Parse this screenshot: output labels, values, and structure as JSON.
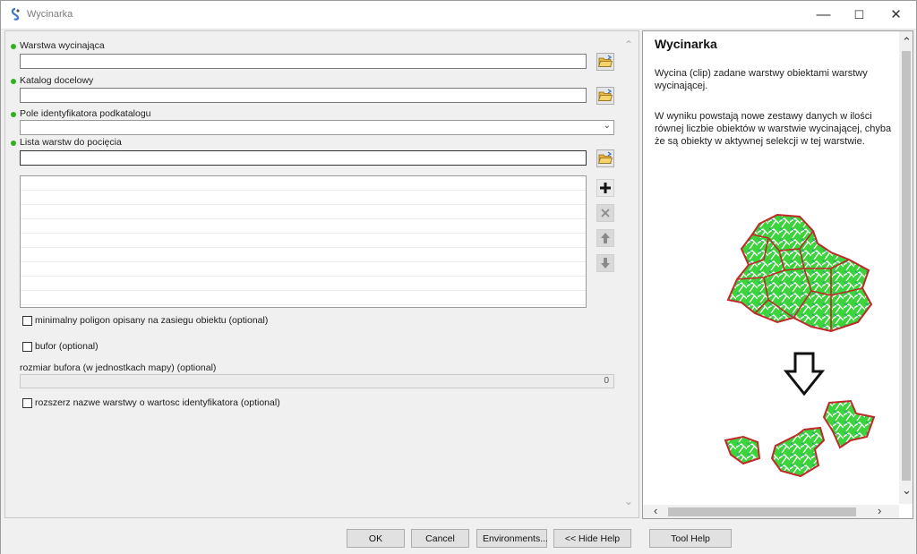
{
  "window": {
    "title": "Wycinarka"
  },
  "fields": {
    "clip_layer": {
      "label": "Warstwa wycinająca",
      "value": ""
    },
    "output_dir": {
      "label": "Katalog docelowy",
      "value": ""
    },
    "subdir_id_field": {
      "label": "Pole identyfikatora podkatalogu",
      "value": ""
    },
    "layers_to_clip": {
      "label": "Lista warstw do pocięcia",
      "value": "",
      "rows": [
        "",
        "",
        "",
        "",
        "",
        "",
        "",
        "",
        ""
      ]
    }
  },
  "options": {
    "min_polygon": {
      "label": "minimalny poligon opisany na zasiegu obiektu (optional)",
      "checked": false
    },
    "buffer": {
      "label": "bufor (optional)",
      "checked": false
    },
    "buffer_size": {
      "label": "rozmiar bufora (w jednostkach mapy) (optional)",
      "value": "0"
    },
    "extend_name": {
      "label": "rozszerz nazwe warstwy o wartosc identyfikatora (optional)",
      "checked": false
    }
  },
  "help": {
    "title": "Wycinarka",
    "paragraph1": "Wycina (clip) zadane warstwy obiektami warstwy wycinającej.",
    "paragraph2": "W wyniku powstają nowe zestawy danych w ilości równej liczbie obiektów w warstwie wycinającej, chyba że są obiekty w aktywnej selekcji w tej warstwie."
  },
  "buttons": {
    "ok": "OK",
    "cancel": "Cancel",
    "environments": "Environments...",
    "hide_help": "<< Hide Help",
    "tool_help": "Tool Help"
  },
  "colors": {
    "required_dot": "#32b020",
    "map_fill": "#3bd43b",
    "map_border": "#c0282a"
  },
  "icons": [
    "app-icon",
    "folder-open-icon",
    "add-icon",
    "remove-icon",
    "move-up-icon",
    "move-down-icon",
    "down-arrow-icon",
    "minimize-icon",
    "maximize-icon",
    "close-icon"
  ]
}
